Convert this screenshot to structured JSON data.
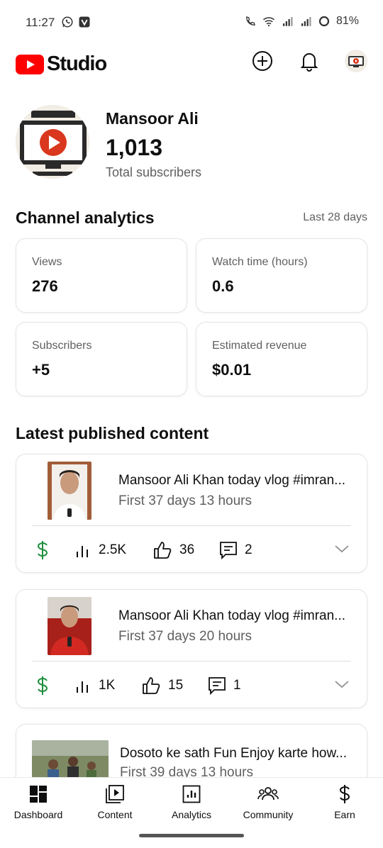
{
  "status_bar": {
    "time": "11:27",
    "battery": "81%"
  },
  "app": {
    "logo_text": "Studio",
    "brand_color": "#ff0000"
  },
  "channel": {
    "name": "Mansoor Ali",
    "subscriber_count": "1,013",
    "subscriber_label": "Total subscribers"
  },
  "analytics": {
    "title": "Channel analytics",
    "range": "Last 28 days",
    "cards": [
      {
        "label": "Views",
        "value": "276"
      },
      {
        "label": "Watch time (hours)",
        "value": "0.6"
      },
      {
        "label": "Subscribers",
        "value": "+5"
      },
      {
        "label": "Estimated revenue",
        "value": "$0.01"
      }
    ]
  },
  "latest": {
    "title": "Latest published content",
    "videos": [
      {
        "title": "Mansoor Ali Khan today vlog #imran...",
        "subtitle": "First 37 days 13 hours",
        "views": "2.5K",
        "likes": "36",
        "comments": "2"
      },
      {
        "title": "Mansoor Ali Khan today vlog #imran...",
        "subtitle": "First 37 days 20 hours",
        "views": "1K",
        "likes": "15",
        "comments": "1"
      },
      {
        "title": "Dosoto ke sath Fun Enjoy karte how...",
        "subtitle": "First 39 days 13 hours"
      }
    ]
  },
  "bottom_nav": {
    "items": [
      {
        "label": "Dashboard",
        "icon": "dashboard-icon"
      },
      {
        "label": "Content",
        "icon": "content-icon"
      },
      {
        "label": "Analytics",
        "icon": "analytics-icon"
      },
      {
        "label": "Community",
        "icon": "community-icon"
      },
      {
        "label": "Earn",
        "icon": "dollar-icon"
      }
    ]
  },
  "colors": {
    "revenue_green": "#1e8e3e",
    "secondary_text": "#606060"
  }
}
